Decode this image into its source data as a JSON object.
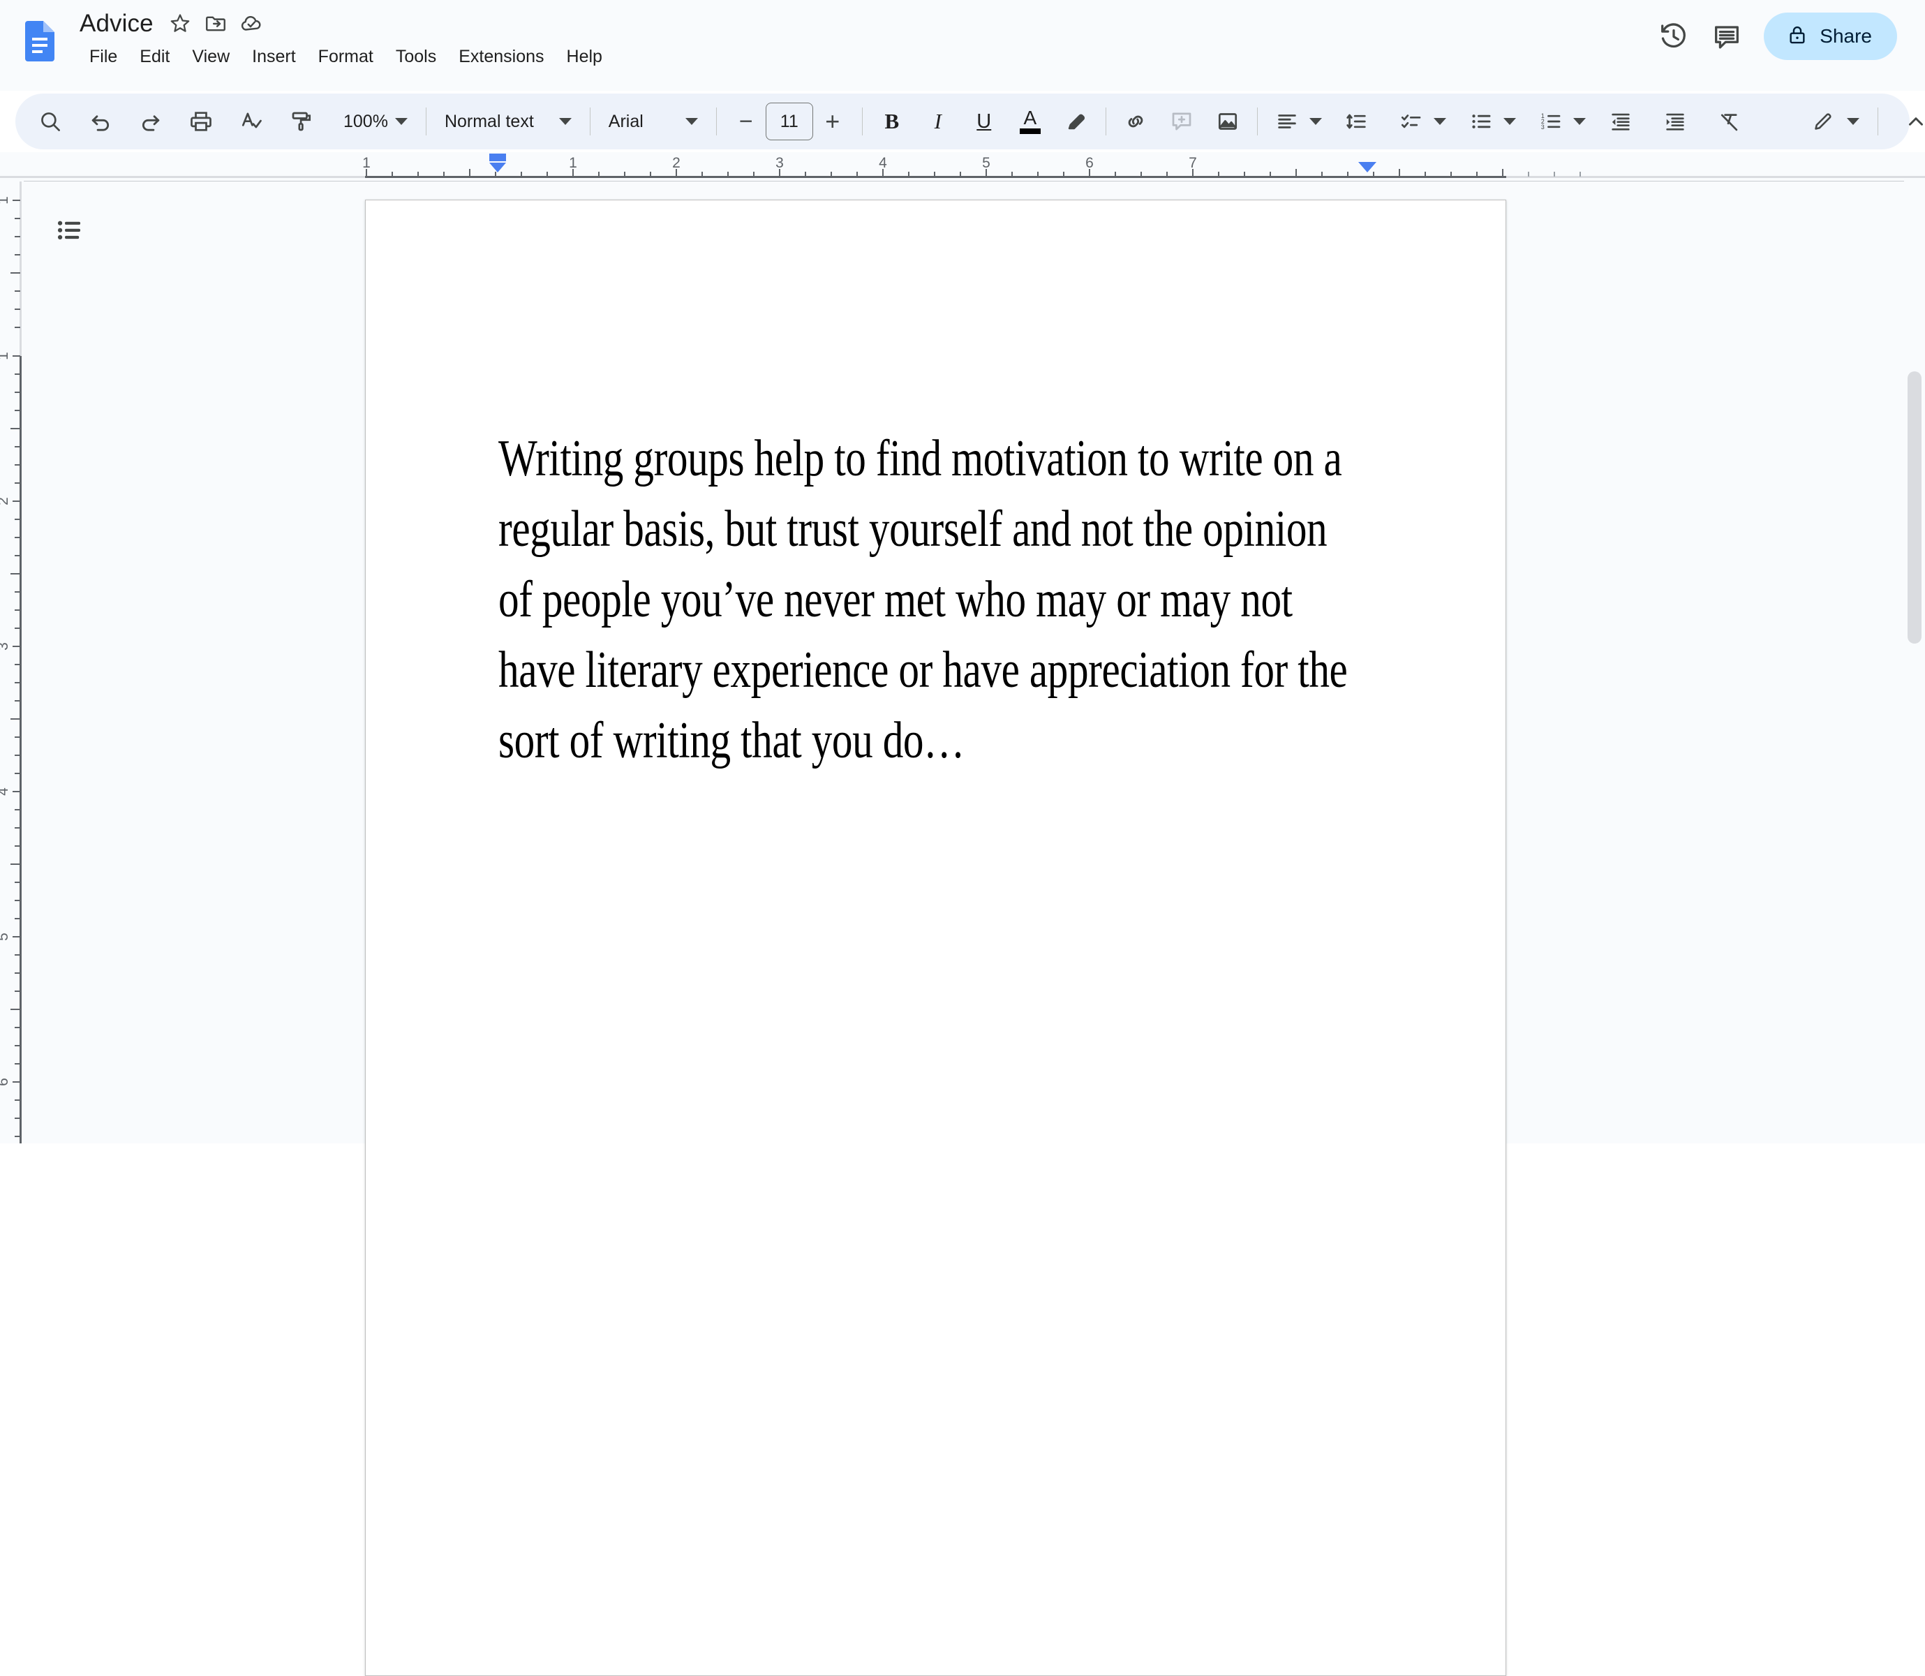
{
  "app": {
    "name": "Google Docs",
    "logo_icon": "docs-file-icon",
    "accent_blue": "#4285f4",
    "toolbar_bg": "#edf2fa",
    "share_bg": "#c2e7ff"
  },
  "header": {
    "doc_title": "Advice",
    "title_actions": [
      {
        "name": "star-icon",
        "icon": "star"
      },
      {
        "name": "move-to-folder-icon",
        "icon": "folder-move"
      },
      {
        "name": "cloud-saved-icon",
        "icon": "cloud-check"
      }
    ],
    "menus": [
      {
        "label": "File"
      },
      {
        "label": "Edit"
      },
      {
        "label": "View"
      },
      {
        "label": "Insert"
      },
      {
        "label": "Format"
      },
      {
        "label": "Tools"
      },
      {
        "label": "Extensions"
      },
      {
        "label": "Help"
      }
    ],
    "right_actions": [
      {
        "name": "version-history-icon",
        "icon": "history"
      },
      {
        "name": "comment-history-icon",
        "icon": "comment"
      }
    ],
    "share": {
      "label": "Share",
      "icon": "lock"
    }
  },
  "toolbar": {
    "search_label": "Search",
    "undo_label": "Undo",
    "redo_label": "Redo",
    "print_label": "Print",
    "spellcheck_label": "Spelling and grammar check",
    "paint_label": "Paint format",
    "zoom_value": "100%",
    "style_value": "Normal text",
    "font_value": "Arial",
    "font_size_value": "11",
    "decrease_font_label": "−",
    "increase_font_label": "+",
    "bold_label": "B",
    "italic_label": "I",
    "underline_label": "U",
    "text_color_label": "A",
    "highlight_label": "Highlight color",
    "link_label": "Insert link",
    "comment_label": "Add comment",
    "image_label": "Insert image",
    "align_label": "Align",
    "line_spacing_label": "Line & paragraph spacing",
    "checklist_label": "Checklist",
    "bulleted_list_label": "Bulleted list",
    "numbered_list_label": "Numbered list",
    "decrease_indent_label": "Decrease indent",
    "increase_indent_label": "Increase indent",
    "clear_formatting_label": "Clear formatting",
    "editing_mode_label": "Editing mode",
    "collapse_label": "Hide the menus"
  },
  "ruler": {
    "horizontal_ticks": [
      "1",
      "1",
      "2",
      "3",
      "4",
      "5",
      "6",
      "7"
    ],
    "vertical_ticks": [
      "1",
      "1",
      "2",
      "3",
      "4",
      "5",
      "6"
    ],
    "left_indent_marker": "left-indent-marker",
    "right_indent_marker": "right-indent-marker"
  },
  "sidebar": {
    "outline_button": "Show document outline"
  },
  "document": {
    "paragraph": "Writing groups help to find motivation to write on a regular basis, but trust yourself and not the opinion of people you’ve never met who may or may not have literary experience or have appreciation for the sort of writing that you do…"
  }
}
